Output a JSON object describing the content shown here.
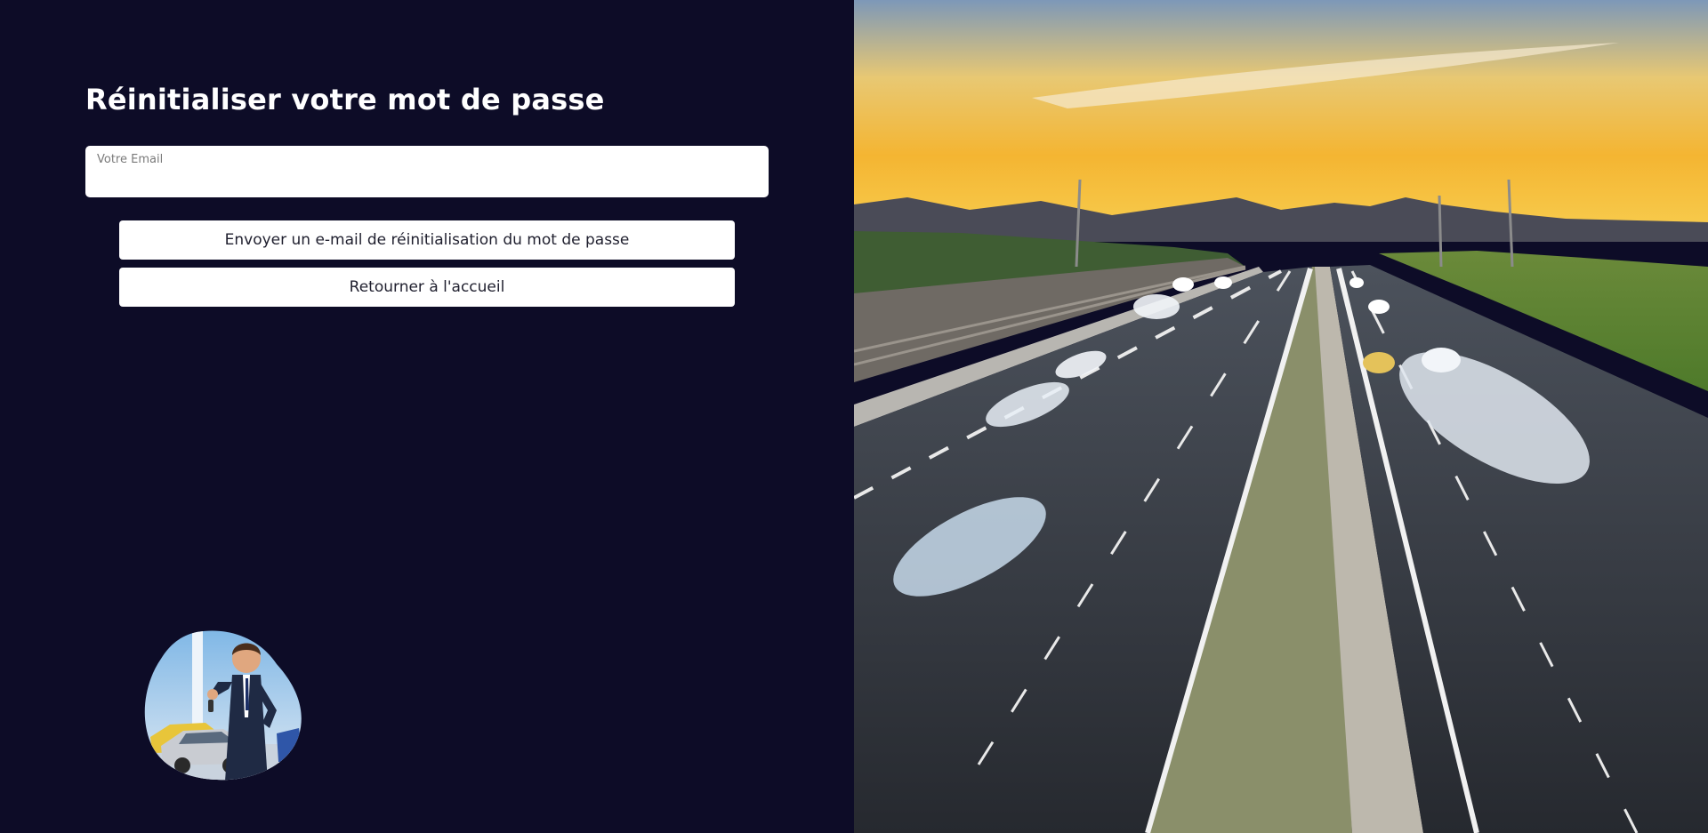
{
  "page": {
    "title": "Réinitialiser votre mot de passe"
  },
  "form": {
    "email_label": "Votre Email",
    "email_value": "",
    "send_button_label": "Envoyer un e-mail de réinitialisation du mot de passe",
    "home_button_label": "Retourner à l'accueil"
  },
  "colors": {
    "background": "#0d0c27",
    "field_background": "#ffffff",
    "button_background": "#ffffff",
    "title_text": "#ffffff"
  },
  "images": {
    "mascot": "businessman-holding-car-key-illustration",
    "hero": "highway-at-sunset-photo"
  }
}
